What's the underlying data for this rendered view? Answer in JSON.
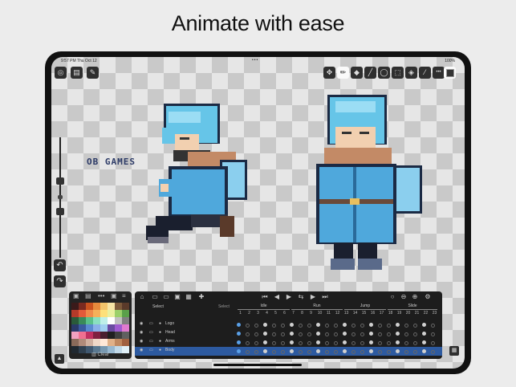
{
  "headline": "Animate with ease",
  "status": {
    "time": "9:57 PM  Thu Oct 12",
    "dots": "•••",
    "right": "100%"
  },
  "watermark": "OB GAMES",
  "left_tools": [
    {
      "name": "layers-icon",
      "glyph": "◎"
    },
    {
      "name": "film-icon",
      "glyph": "▤"
    },
    {
      "name": "wrench-icon",
      "glyph": "✎"
    }
  ],
  "right_tools": [
    {
      "name": "move-icon",
      "glyph": "✥",
      "active": false
    },
    {
      "name": "pencil-icon",
      "glyph": "✏",
      "active": true
    },
    {
      "name": "eraser-icon",
      "glyph": "◆",
      "active": false
    },
    {
      "name": "line-icon",
      "glyph": "╱",
      "active": false
    },
    {
      "name": "ellipse-icon",
      "glyph": "◯",
      "active": false
    },
    {
      "name": "select-rect-icon",
      "glyph": "⬚",
      "active": false
    },
    {
      "name": "fill-icon",
      "glyph": "◈",
      "active": false
    },
    {
      "name": "eyedropper-icon",
      "glyph": "⁄",
      "active": false
    },
    {
      "name": "more-icon",
      "glyph": "•••",
      "active": false
    }
  ],
  "palette": {
    "clear_label": "Clear",
    "colors": [
      "#3a1a1a",
      "#7a2a20",
      "#c8521f",
      "#e58a3c",
      "#f2c46a",
      "#f6e5a5",
      "#7d5a3a",
      "#5a3a2a",
      "#b43a2a",
      "#e35a3a",
      "#f08a4a",
      "#f6b05a",
      "#fde07a",
      "#e8f0a0",
      "#9ad06a",
      "#5aa04a",
      "#2a5a3a",
      "#3a8a5a",
      "#5ac08a",
      "#8ae0c0",
      "#bff0e8",
      "#ffffff",
      "#c0c0c0",
      "#808080",
      "#2a3a6a",
      "#3a5aa0",
      "#5a8ad0",
      "#8ab0e8",
      "#a0d0f0",
      "#6a4aa0",
      "#a05ad0",
      "#e07ad0",
      "#f0a0c0",
      "#f07090",
      "#c03060",
      "#802040",
      "#4a2030",
      "#202020",
      "#404040",
      "#606060",
      "#8a6a5a",
      "#b08a7a",
      "#d0b0a0",
      "#f0d8c8",
      "#ffe8d8",
      "#e0b088",
      "#c08860",
      "#a06040",
      "#202830",
      "#304050",
      "#405870",
      "#5a7890",
      "#7898b0",
      "#98b8d0",
      "#c0d8e8",
      "#e0f0f8"
    ]
  },
  "timeline": {
    "select_label": "Select",
    "select_label_2": "Select",
    "tags": [
      "Idle",
      "Run",
      "Jump",
      "Slide"
    ],
    "frame_numbers": [
      "1",
      "2",
      "3",
      "4",
      "5",
      "6",
      "7",
      "8",
      "9",
      "10",
      "11",
      "12",
      "13",
      "14",
      "15",
      "16",
      "17",
      "18",
      "19",
      "20",
      "21",
      "22",
      "23"
    ],
    "layers": [
      "Logo",
      "Head",
      "Arms",
      "Body"
    ]
  }
}
